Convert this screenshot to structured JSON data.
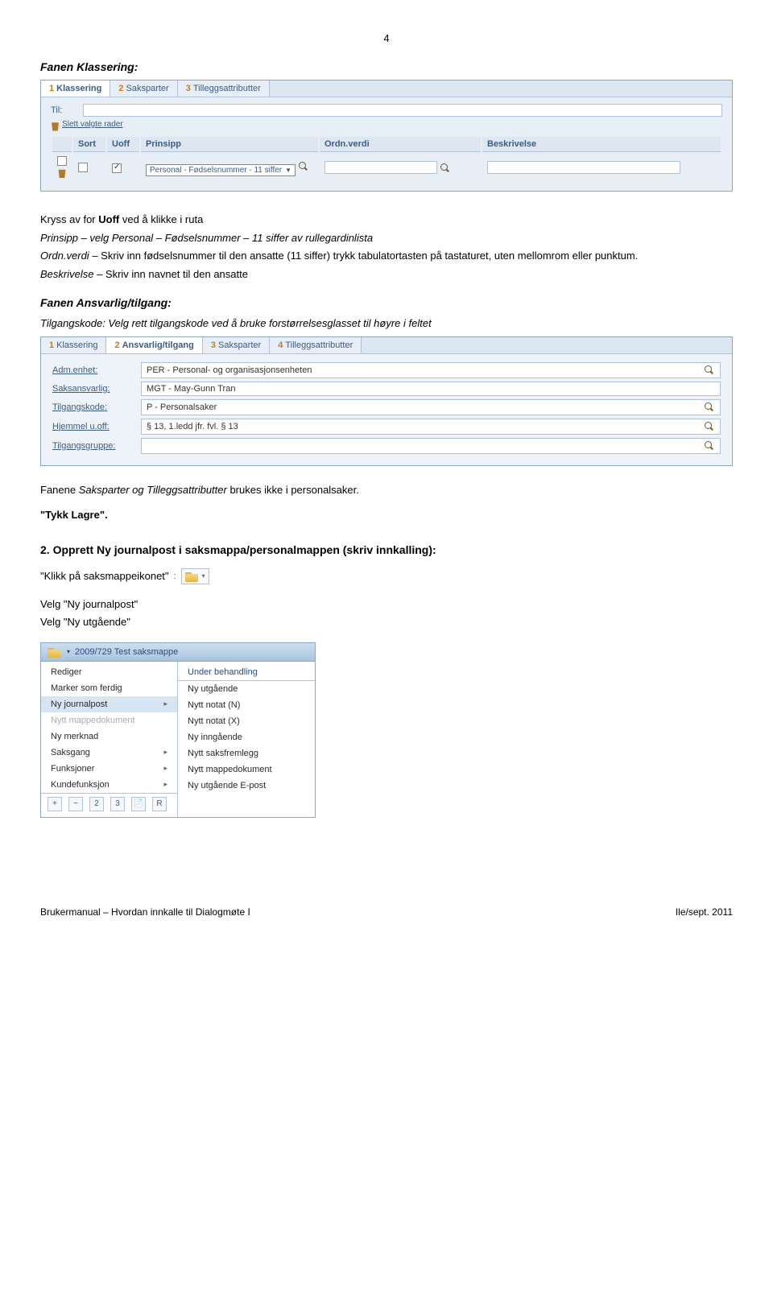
{
  "page_number": "4",
  "heading1": "Fanen Klassering:",
  "screenshot1": {
    "tabs": [
      "Klassering",
      "Saksparter",
      "Tilleggsattributter"
    ],
    "til_label": "Til:",
    "delete_rows": "Slett valgte rader",
    "columns": [
      "Sort",
      "Uoff",
      "Prinsipp",
      "Ordn.verdi",
      "Beskrivelse"
    ],
    "row_prinsipp": "Personal - Fødselsnummer - 11 siffer"
  },
  "para1_line1_prefix": "Kryss av for ",
  "para1_uoff": "Uoff",
  "para1_line1_suffix": " ved å klikke i ruta",
  "para1_line2": "Prinsipp – velg Personal – Fødselsnummer – 11 siffer av rullegardinlista",
  "para1_line3": "Ordn.verdi – Skriv inn fødselsnummer til den ansatte (11 siffer) trykk tabulatortasten på tastaturet, uten mellomrom eller punktum.",
  "para1_line4": "Beskrivelse – Skriv inn navnet til den ansatte",
  "heading2": "Fanen Ansvarlig/tilgang:",
  "para2": "Tilgangskode: Velg rett tilgangskode ved å bruke forstørrelsesglasset til høyre i feltet",
  "screenshot2": {
    "tabs": [
      "Klassering",
      "Ansvarlig/tilgang",
      "Saksparter",
      "Tilleggsattributter"
    ],
    "fields": [
      {
        "label": "Adm.enhet:",
        "value": "PER - Personal- og organisasjonsenheten"
      },
      {
        "label": "Saksansvarlig:",
        "value": "MGT - May-Gunn Tran"
      },
      {
        "label": "Tilgangskode:",
        "value": "P - Personalsaker"
      },
      {
        "label": "Hjemmel u.off:",
        "value": "§ 13, 1.ledd jfr. fvl. § 13"
      },
      {
        "label": "Tilgangsgruppe:",
        "value": ""
      }
    ]
  },
  "para3_prefix": "Fanene ",
  "para3_italic": "Saksparter og Tilleggsattributter",
  "para3_suffix": " brukes ikke i personalsaker.",
  "para4": "\"Tykk Lagre\".",
  "section2_heading": "2. Opprett Ny journalpost i saksmappa/personalmappen (skriv innkalling):",
  "para5": "\"Klikk på saksmappeikonet\"",
  "para6_l1": "Velg \"Ny journalpost\"",
  "para6_l2": "Velg \"Ny utgående\"",
  "menu": {
    "title": "2009/729  Test saksmappe",
    "left": [
      {
        "text": "Rediger"
      },
      {
        "text": "Marker som ferdig"
      },
      {
        "text": "Ny journalpost",
        "sub": true,
        "hl": true
      },
      {
        "text": "Nytt mappedokument",
        "disabled": true
      },
      {
        "text": "Ny merknad"
      },
      {
        "text": "Saksgang",
        "sub": true
      },
      {
        "text": "Funksjoner",
        "sub": true
      },
      {
        "text": "Kundefunksjon",
        "sub": true
      }
    ],
    "right_status": "Under behandling",
    "right": [
      {
        "text": "Ny utgående"
      },
      {
        "text": "Nytt notat (N)"
      },
      {
        "text": "Nytt notat (X)"
      },
      {
        "text": "Ny inngående"
      },
      {
        "text": "Nytt saksfremlegg"
      },
      {
        "text": "Nytt mappedokument"
      },
      {
        "text": "Ny utgående E-post"
      }
    ],
    "foot": [
      "+",
      "−",
      "2",
      "3",
      "R"
    ]
  },
  "footer_left": "Brukermanual – Hvordan innkalle til Dialogmøte I",
  "footer_right": "Ile/sept. 2011"
}
